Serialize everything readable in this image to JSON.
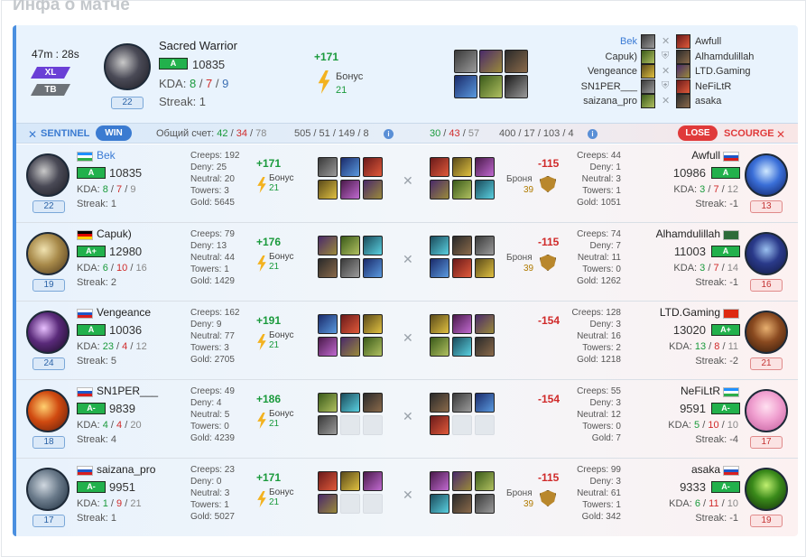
{
  "page_title": "Инфа о матче",
  "summary": {
    "duration": "47m : 28s",
    "tag_xl": "XL",
    "tag_tb": "TB",
    "hero_level": "22",
    "player": "Sacred Warrior",
    "rank": "A",
    "mmr": "10835",
    "kda_label": "KDA:",
    "k": "8",
    "d": "7",
    "a": "9",
    "streak": "Streak: 1",
    "gain": "+171",
    "bonus_label": "Бонус",
    "bonus": "21",
    "vs_left": [
      "Bek",
      "Capuk)",
      "Vengeance",
      "SN1PER___",
      "saizana_pro"
    ],
    "vs_right": [
      "Awfull",
      "Alhamdulillah",
      "LTD.Gaming",
      "NeFiLtR",
      "asaka"
    ]
  },
  "scorebar": {
    "sentinel": "SENTINEL",
    "win": "WIN",
    "total_label": "Общий счет:",
    "s_k": "42",
    "s_d": "34",
    "s_a": "78",
    "s_stats": "505 / 51 / 149 / 8",
    "g_k": "30",
    "g_d": "43",
    "g_a": "57",
    "g_stats": "400 / 17 / 103 / 4",
    "lose": "LOSE",
    "scourge": "SCOURGE"
  },
  "rows": [
    {
      "l_name": "Bek",
      "l_rank": "A",
      "l_mmr": "10835",
      "l_k": "8",
      "l_d": "7",
      "l_a": "9",
      "l_streak": "Streak: 1",
      "l_lvl": "22",
      "l_stats": [
        "Creeps: 192",
        "Deny: 25",
        "Neutral: 20",
        "Towers: 3",
        "Gold: 5645"
      ],
      "l_gain": "+171",
      "bonus": "21",
      "r_gain": "-115",
      "armor": "Броня",
      "armor_v": "39",
      "r_stats": [
        "Creeps: 44",
        "Deny: 1",
        "Neutral: 3",
        "Towers: 1",
        "Gold: 1051"
      ],
      "r_name": "Awfull",
      "r_rank": "A",
      "r_mmr": "10986",
      "r_k": "3",
      "r_d": "7",
      "r_a": "12",
      "r_streak": "Streak: -1",
      "r_lvl": "13"
    },
    {
      "l_name": "Capuk)",
      "l_rank": "A+",
      "l_mmr": "12980",
      "l_k": "6",
      "l_d": "10",
      "l_a": "16",
      "l_streak": "Streak: 2",
      "l_lvl": "19",
      "l_stats": [
        "Creeps: 79",
        "Deny: 13",
        "Neutral: 44",
        "Towers: 1",
        "Gold: 1429"
      ],
      "l_gain": "+176",
      "bonus": "21",
      "r_gain": "-115",
      "armor": "Броня",
      "armor_v": "39",
      "r_stats": [
        "Creeps: 74",
        "Deny: 7",
        "Neutral: 11",
        "Towers: 0",
        "Gold: 1262"
      ],
      "r_name": "Alhamdulillah",
      "r_rank": "A",
      "r_mmr": "11003",
      "r_k": "3",
      "r_d": "7",
      "r_a": "14",
      "r_streak": "Streak: -1",
      "r_lvl": "16"
    },
    {
      "l_name": "Vengeance",
      "l_rank": "A",
      "l_mmr": "10036",
      "l_k": "23",
      "l_d": "4",
      "l_a": "12",
      "l_streak": "Streak: 5",
      "l_lvl": "24",
      "l_stats": [
        "Creeps: 162",
        "Deny: 9",
        "Neutral: 77",
        "Towers: 3",
        "Gold: 2705"
      ],
      "l_gain": "+191",
      "bonus": "21",
      "r_gain": "-154",
      "armor": "",
      "armor_v": "",
      "r_stats": [
        "Creeps: 128",
        "Deny: 3",
        "Neutral: 16",
        "Towers: 2",
        "Gold: 1218"
      ],
      "r_name": "LTD.Gaming",
      "r_rank": "A+",
      "r_mmr": "13020",
      "r_k": "13",
      "r_d": "8",
      "r_a": "11",
      "r_streak": "Streak: -2",
      "r_lvl": "21"
    },
    {
      "l_name": "SN1PER___",
      "l_rank": "A-",
      "l_mmr": "9839",
      "l_k": "4",
      "l_d": "4",
      "l_a": "20",
      "l_streak": "Streak: 4",
      "l_lvl": "18",
      "l_stats": [
        "Creeps: 49",
        "Deny: 4",
        "Neutral: 5",
        "Towers: 0",
        "Gold: 4239"
      ],
      "l_gain": "+186",
      "bonus": "21",
      "r_gain": "-154",
      "armor": "",
      "armor_v": "",
      "r_stats": [
        "Creeps: 55",
        "Deny: 3",
        "Neutral: 12",
        "Towers: 0",
        "Gold: 7"
      ],
      "r_name": "NeFiLtR",
      "r_rank": "A-",
      "r_mmr": "9591",
      "r_k": "5",
      "r_d": "10",
      "r_a": "10",
      "r_streak": "Streak: -4",
      "r_lvl": "17"
    },
    {
      "l_name": "saizana_pro",
      "l_rank": "A-",
      "l_mmr": "9951",
      "l_k": "1",
      "l_d": "9",
      "l_a": "21",
      "l_streak": "Streak: 1",
      "l_lvl": "17",
      "l_stats": [
        "Creeps: 23",
        "Deny: 0",
        "Neutral: 3",
        "Towers: 1",
        "Gold: 5027"
      ],
      "l_gain": "+171",
      "bonus": "21",
      "r_gain": "-115",
      "armor": "Броня",
      "armor_v": "39",
      "r_stats": [
        "Creeps: 99",
        "Deny: 3",
        "Neutral: 61",
        "Towers: 1",
        "Gold: 342"
      ],
      "r_name": "asaka",
      "r_rank": "A-",
      "r_mmr": "9333",
      "r_k": "6",
      "r_d": "11",
      "r_a": "10",
      "r_streak": "Streak: -1",
      "r_lvl": "19"
    }
  ],
  "colors": {
    "accent": "#4a8fe0",
    "win": "#3b7bd1",
    "lose": "#e03a3a",
    "rank": "#22b14c",
    "gain": "#1a9a3c",
    "loss": "#d02a2a"
  }
}
